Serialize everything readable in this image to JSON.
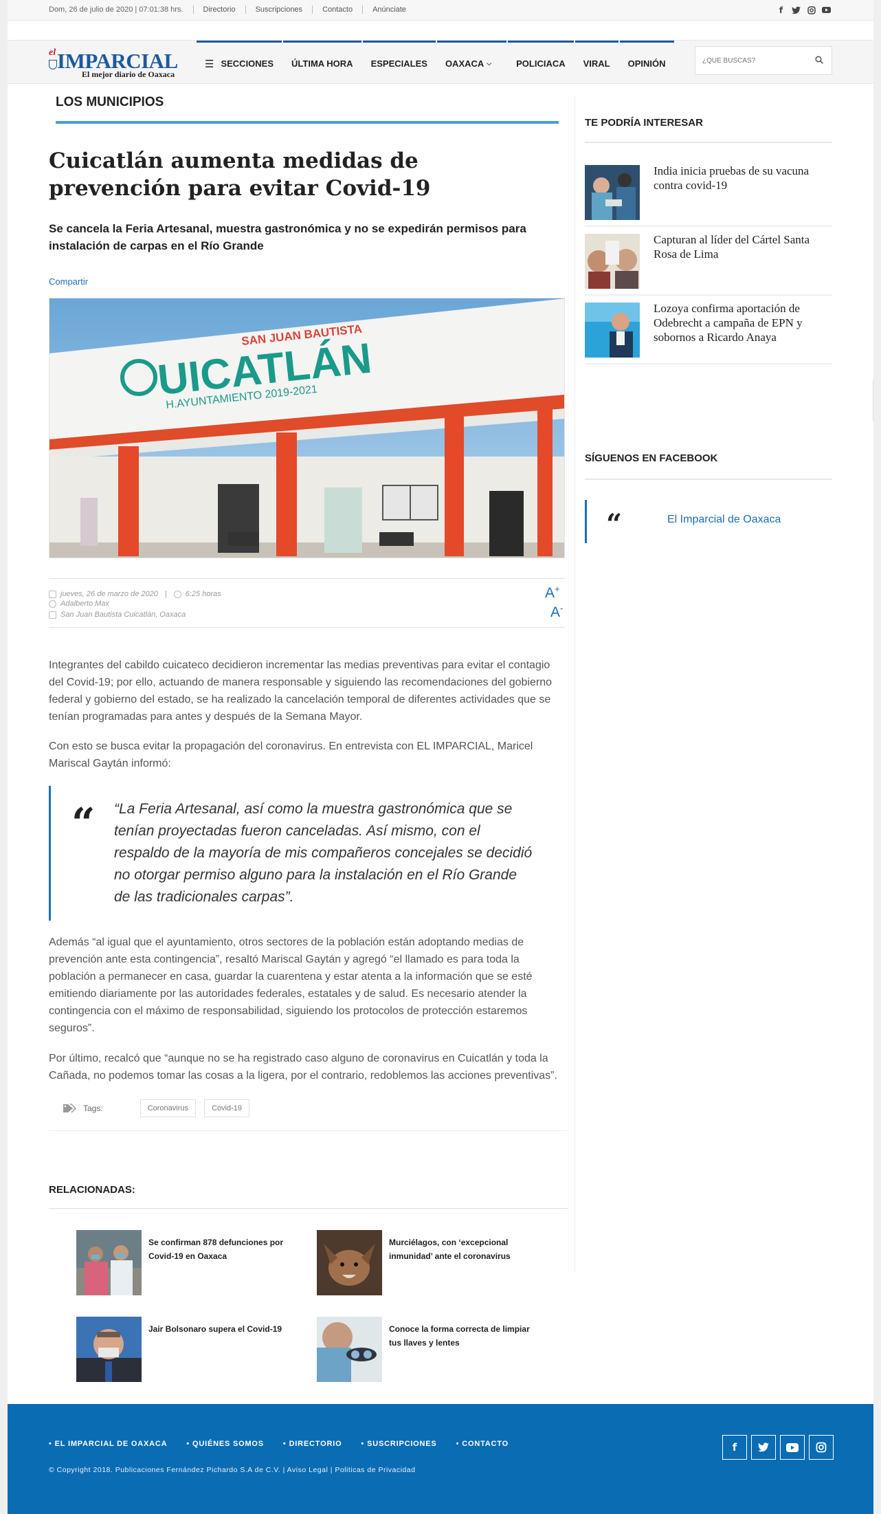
{
  "topbar": {
    "datetime": "Dom, 26 de julio de 2020 | 07:01:38 hrs.",
    "links": [
      "Directorio",
      "Suscripciones",
      "Contacto",
      "Anúnciate"
    ],
    "social": [
      "facebook-icon",
      "twitter-icon",
      "instagram-icon",
      "youtube-icon"
    ]
  },
  "logo": {
    "prefix": "el",
    "name": "IMPARCIAL",
    "tagline": "El mejor diario de Oaxaca"
  },
  "nav": {
    "items": [
      "SECCIONES",
      "ÚLTIMA HORA",
      "ESPECIALES",
      "OAXACA",
      "POLICIACA",
      "VIRAL",
      "OPINIÓN"
    ]
  },
  "search": {
    "placeholder": "¿QUÉ BUSCAS?"
  },
  "article": {
    "section": "LOS MUNICIPIOS",
    "title": "Cuicatlán aumenta medidas de prevención para evitar Covid-19",
    "subtitle": "Se cancela la Feria Artesanal, muestra gastronómica y no se expedirán permisos para instalación de carpas en el Río Grande",
    "share_label": "Compartir",
    "image": {
      "sign_top": "SAN JUAN BAUTISTA",
      "sign_main": "UICATLÁN",
      "sign_sub": "H.AYUNTAMIENTO 2019-2021"
    },
    "date": "jueves, 26 de marzo de 2020",
    "time": "6:25 horas",
    "author": "Adalberto Max",
    "location": "San Juan Bautista Cuicatlán, Oaxaca",
    "font_up": "A",
    "font_down": "A",
    "paragraphs": [
      " Integrantes del cabildo cuicateco decidieron incrementar las medias preventivas para evitar el contagio del Covid-19; por ello, actuando de manera responsable y siguiendo las recomendaciones del gobierno federal y gobierno del estado, se ha realizado la cancelación temporal de diferentes actividades que se tenían programadas para antes y después de la Semana Mayor.",
      "Con esto se busca evitar la propagación del coronavirus. En entrevista con EL IMPARCIAL, Maricel Mariscal Gaytán informó:",
      "Además “al igual que el ayuntamiento, otros sectores de la población están adoptando medias de prevención ante esta contingencia”, resaltó Mariscal Gaytán y agregó “el llamado es para toda la población a permanecer en casa, guardar la cuarentena y estar atenta a la información que se esté emitiendo diariamente por las autoridades federales, estatales y de salud. Es necesario atender la contingencia con el máximo de responsabilidad, siguiendo los protocolos de protección estaremos seguros”.",
      "Por último, recalcó que “aunque no se ha registrado caso alguno de coronavirus en Cuicatlán y toda la Cañada, no podemos tomar las cosas a la ligera, por el contrario, redoblemos las acciones preventivas”."
    ],
    "quote": "“La Feria Artesanal, así como la muestra gastronómica que se tenían proyectadas fueron canceladas. Así mismo, con el respaldo de la mayoría de mis compañeros concejales se decidió no otorgar permiso alguno para la instalación en el Río Grande de las tradicionales carpas”.",
    "tags_label": "Tags:",
    "tags": [
      "Coronavirus",
      "Covid-19"
    ]
  },
  "related": {
    "title": "RELACIONADAS:",
    "items": [
      "Se confirman 878 defunciones por Covid-19 en Oaxaca",
      "Murciélagos, con ‘excepcional inmunidad’ ante el coronavirus",
      "Jair Bolsonaro supera el Covid-19",
      "Conoce la forma correcta de limpiar tus llaves y lentes"
    ]
  },
  "sidebar": {
    "interest_title": "TE PODRÍA INTERESAR",
    "items": [
      "India inicia pruebas de su vacuna contra covid-19",
      "Capturan al líder del Cártel Santa Rosa de Lima",
      "Lozoya confirma aportación de Odebrecht a campaña de EPN y sobornos a Ricardo Anaya"
    ],
    "facebook_title": "SÍGUENOS EN FACEBOOK",
    "facebook_link": "El Imparcial de Oaxaca"
  },
  "footer": {
    "links": [
      "EL IMPARCIAL DE OAXACA",
      "QUIÉNES SOMOS",
      "DIRECTORIO",
      "SUSCRIPCIONES",
      "CONTACTO"
    ],
    "copyright": "© Copyright 2018. Publicaciones Fernández Pichardo S.A de C.V. | Aviso Legal | Politicas de Privacidad",
    "social": [
      "facebook-icon",
      "twitter-icon",
      "youtube-icon",
      "instagram-icon"
    ]
  },
  "colors": {
    "accent": "#1d6fb8",
    "footer_bg": "#0a6cb3",
    "section_line": "#4a9bd4"
  }
}
